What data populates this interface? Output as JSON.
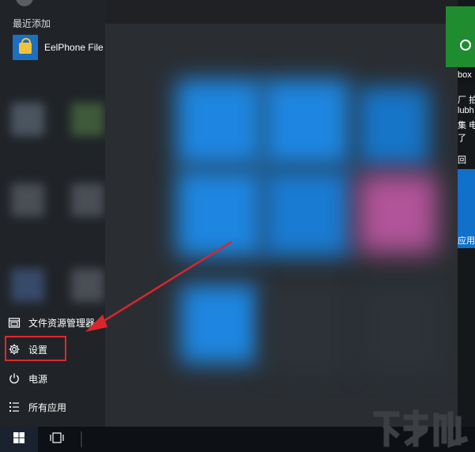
{
  "start_menu": {
    "recent_label": "最近添加",
    "recent_app": {
      "label": "EelPhone File",
      "icon": "shopping-bag-icon"
    },
    "bottom_items": [
      {
        "label": "文件资源管理器",
        "icon": "file-explorer-icon"
      },
      {
        "label": "设置",
        "icon": "gear-icon"
      },
      {
        "label": "电源",
        "icon": "power-icon"
      },
      {
        "label": "所有应用",
        "icon": "list-icon"
      }
    ]
  },
  "right_strip": {
    "xbox_text": "box",
    "news_lines": [
      "厂 拍",
      "lubh",
      "集 电",
      "了 ",
      "回 "
    ],
    "tile_caption": "应用商"
  },
  "taskbar": {
    "start_icon": "windows-logo-icon",
    "taskview_icon": "task-view-icon"
  },
  "colors": {
    "highlight": "#e3262d",
    "tile_green": "#1e8c2f",
    "tile_blue": "#1170c9"
  }
}
